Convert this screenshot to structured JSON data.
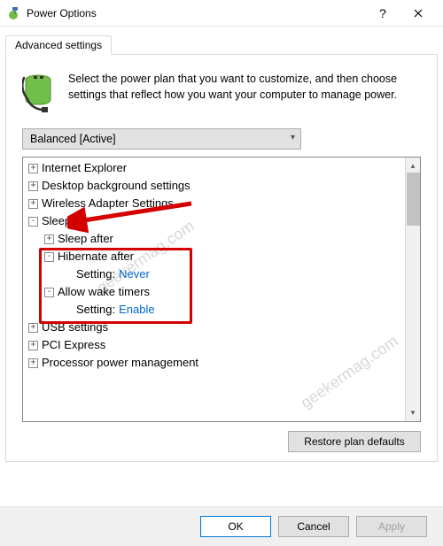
{
  "window": {
    "title": "Power Options"
  },
  "tab": {
    "label": "Advanced settings"
  },
  "intro": "Select the power plan that you want to customize, and then choose settings that reflect how you want your computer to manage power.",
  "plan_selected": "Balanced [Active]",
  "tree": {
    "n0": {
      "label": "Internet Explorer"
    },
    "n1": {
      "label": "Desktop background settings"
    },
    "n2": {
      "label": "Wireless Adapter Settings"
    },
    "n3": {
      "label": "Sleep"
    },
    "n3a": {
      "label": "Sleep after"
    },
    "n3b": {
      "label": "Hibernate after"
    },
    "n3b_s": {
      "key": "Setting:",
      "val": "Never"
    },
    "n3c": {
      "label": "Allow wake timers"
    },
    "n3c_s": {
      "key": "Setting:",
      "val": "Enable"
    },
    "n4": {
      "label": "USB settings"
    },
    "n5": {
      "label": "PCI Express"
    },
    "n6": {
      "label": "Processor power management"
    }
  },
  "buttons": {
    "restore": "Restore plan defaults",
    "ok": "OK",
    "cancel": "Cancel",
    "apply": "Apply"
  },
  "watermark": "geekermag.com"
}
